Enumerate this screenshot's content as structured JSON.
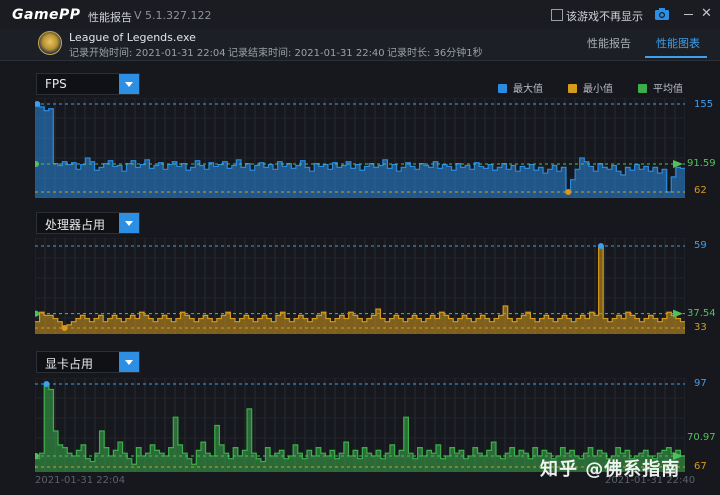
{
  "app": {
    "brand": "GamePP",
    "title": "性能报告",
    "version": "V 5.1.327.122",
    "hide_checkbox_label": "该游戏不再显示"
  },
  "session": {
    "exe": "League of Legends.exe",
    "start_label": "记录开始时间: 2021-01-31 22:04",
    "end_label": "记录结束时间: 2021-01-31 22:40",
    "duration_label": "记录时长: 36分钟1秒"
  },
  "tabs": [
    {
      "label": "性能报告",
      "active": false
    },
    {
      "label": "性能图表",
      "active": true
    }
  ],
  "legend": [
    {
      "label": "最大值",
      "color": "#2b8be0"
    },
    {
      "label": "最小值",
      "color": "#d69a1d"
    },
    {
      "label": "平均值",
      "color": "#3cae4a"
    }
  ],
  "chart_data": [
    {
      "type": "area",
      "selector_label": "FPS",
      "max": 155,
      "min": 62,
      "avg": 91.59,
      "max_label": "155",
      "min_label": "62",
      "avg_label": "91.59",
      "color": "#2b8be0",
      "values": [
        155,
        152,
        148,
        150,
        92,
        90,
        94,
        91,
        93,
        86,
        91,
        98,
        94,
        85,
        88,
        92,
        95,
        89,
        90,
        84,
        92,
        95,
        88,
        91,
        96,
        87,
        90,
        93,
        86,
        91,
        94,
        89,
        92,
        85,
        88,
        95,
        90,
        86,
        93,
        89,
        91,
        94,
        87,
        90,
        96,
        88,
        92,
        85,
        90,
        93,
        88,
        91,
        86,
        94,
        89,
        92,
        87,
        90,
        95,
        88,
        84,
        92,
        89,
        91,
        86,
        93,
        88,
        90,
        94,
        87,
        91,
        85,
        89,
        92,
        88,
        90,
        96,
        87,
        91,
        84,
        88,
        93,
        89,
        86,
        92,
        90,
        88,
        94,
        87,
        91,
        89,
        85,
        92,
        88,
        90,
        86,
        93,
        89,
        87,
        91,
        85,
        88,
        92,
        86,
        90,
        84,
        89,
        87,
        91,
        85,
        88,
        82,
        86,
        90,
        84,
        88,
        62,
        75,
        86,
        98,
        94,
        89,
        84,
        92,
        88,
        86,
        90,
        84,
        80,
        88,
        85,
        91,
        86,
        89,
        84,
        88,
        82,
        86,
        62,
        78,
        88,
        87
      ]
    },
    {
      "type": "area",
      "selector_label": "处理器占用",
      "max": 59,
      "min": 33,
      "avg": 37.54,
      "max_label": "59",
      "min_label": "33",
      "avg_label": "37.54",
      "color": "#d69a1d",
      "values": [
        35,
        38,
        37,
        37,
        36,
        35,
        33,
        34,
        35,
        36,
        37,
        36,
        35,
        36,
        37,
        35,
        36,
        37,
        36,
        35,
        36,
        37,
        36,
        38,
        37,
        36,
        35,
        36,
        37,
        36,
        35,
        36,
        38,
        37,
        36,
        35,
        36,
        37,
        36,
        35,
        36,
        37,
        38,
        36,
        35,
        36,
        37,
        36,
        35,
        36,
        37,
        36,
        35,
        37,
        38,
        36,
        35,
        36,
        37,
        36,
        35,
        36,
        37,
        38,
        36,
        35,
        36,
        37,
        36,
        38,
        37,
        36,
        35,
        36,
        37,
        39,
        36,
        35,
        36,
        37,
        36,
        35,
        36,
        37,
        36,
        35,
        36,
        37,
        36,
        38,
        37,
        36,
        35,
        36,
        37,
        36,
        35,
        36,
        37,
        36,
        35,
        36,
        37,
        40,
        36,
        35,
        36,
        37,
        38,
        36,
        35,
        36,
        37,
        36,
        35,
        36,
        37,
        36,
        35,
        36,
        37,
        36,
        38,
        37,
        59,
        36,
        35,
        36,
        37,
        36,
        38,
        37,
        36,
        35,
        36,
        37,
        36,
        35,
        36,
        38,
        37,
        36,
        35
      ]
    },
    {
      "type": "area",
      "selector_label": "显卡占用",
      "max": 97,
      "min": 67,
      "avg": 70.97,
      "max_label": "97",
      "min_label": "67",
      "avg_label": "70.97",
      "color": "#3cae4a",
      "values": [
        70,
        72,
        97,
        95,
        80,
        75,
        74,
        72,
        71,
        73,
        75,
        70,
        69,
        72,
        80,
        74,
        71,
        73,
        76,
        72,
        70,
        68,
        74,
        71,
        72,
        75,
        73,
        72,
        71,
        74,
        85,
        75,
        72,
        70,
        68,
        73,
        76,
        72,
        71,
        82,
        75,
        72,
        70,
        74,
        71,
        73,
        88,
        72,
        70,
        69,
        74,
        71,
        72,
        73,
        70,
        71,
        75,
        72,
        70,
        73,
        71,
        74,
        72,
        71,
        73,
        70,
        72,
        76,
        71,
        73,
        70,
        74,
        72,
        71,
        73,
        70,
        72,
        75,
        71,
        73,
        85,
        72,
        70,
        74,
        71,
        73,
        72,
        75,
        70,
        71,
        74,
        72,
        73,
        70,
        71,
        74,
        72,
        71,
        73,
        76,
        71,
        70,
        72,
        74,
        71,
        73,
        72,
        70,
        74,
        71,
        73,
        72,
        70,
        71,
        74,
        72,
        73,
        71,
        70,
        72,
        74,
        71,
        73,
        72,
        70,
        71,
        74,
        72,
        73,
        70,
        71,
        72,
        73,
        71,
        70,
        72,
        73,
        74,
        72,
        73,
        71
      ]
    }
  ],
  "time_axis": {
    "start": "2021-01-31 22:04",
    "end": "2021-01-31 22:40"
  },
  "watermark": "知乎 @佛系指南"
}
